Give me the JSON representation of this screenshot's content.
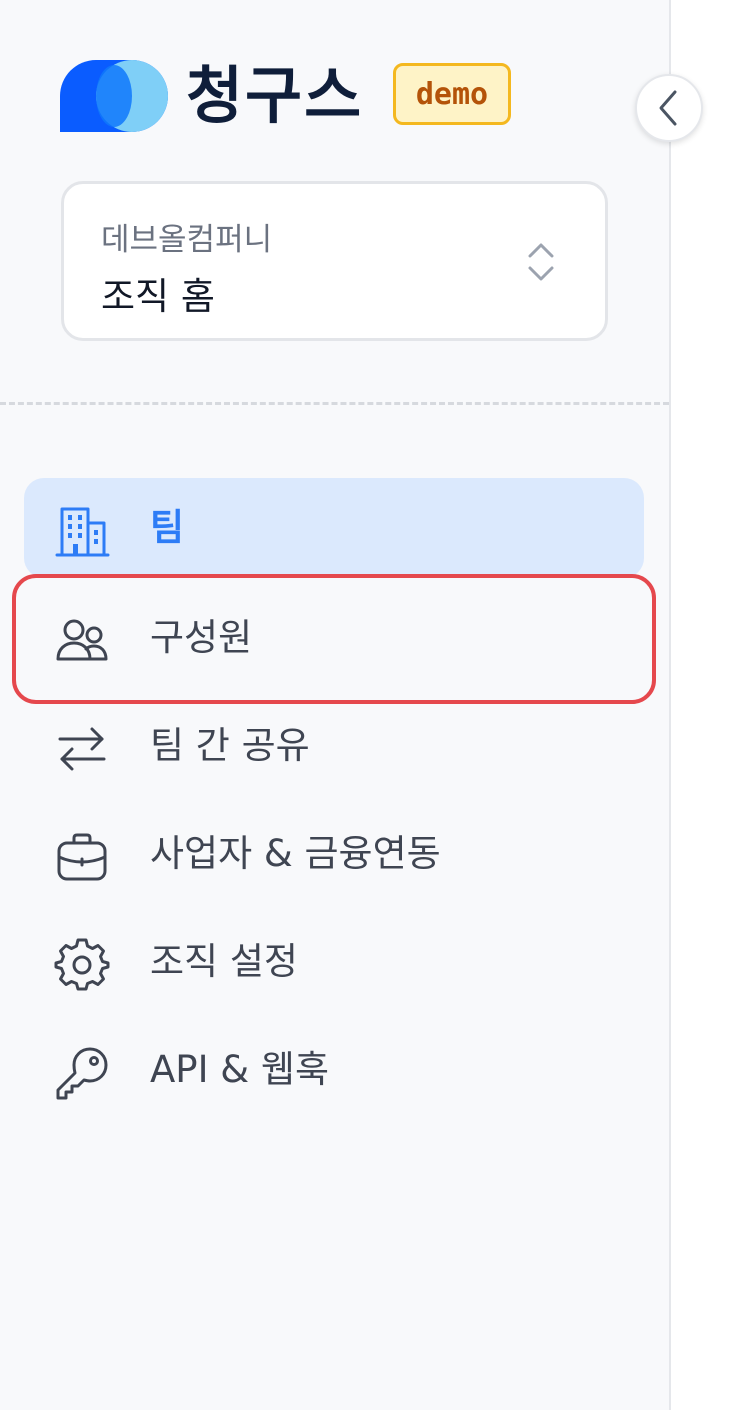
{
  "brand": {
    "name": "청구스",
    "badge": "demo",
    "logo_icon": "brand-logo-icon",
    "colors": {
      "logo_dark": "#0a5cff",
      "logo_light": "#7fcff7",
      "badge_border": "#f4b81f",
      "badge_bg": "#fef3c7",
      "badge_text": "#b45309"
    }
  },
  "sidebar": {
    "collapse_icon": "chevron-left-icon",
    "org_selector": {
      "org_name": "데브올컴퍼니",
      "current_page": "조직 홈",
      "icon": "chevron-up-down-icon"
    },
    "nav": [
      {
        "label": "팀",
        "icon": "building-icon",
        "active": true
      },
      {
        "label": "구성원",
        "icon": "users-icon",
        "active": false,
        "highlighted": true
      },
      {
        "label": "팀 간 공유",
        "icon": "arrows-swap-icon",
        "active": false
      },
      {
        "label": "사업자 & 금융연동",
        "icon": "briefcase-icon",
        "active": false
      },
      {
        "label": "조직 설정",
        "icon": "gear-icon",
        "active": false
      },
      {
        "label": "API & 웹훅",
        "icon": "key-icon",
        "active": false
      }
    ],
    "colors": {
      "active_bg": "#dbe9fd",
      "active_text": "#2d7cf6",
      "highlight_border": "#e5484d"
    }
  }
}
